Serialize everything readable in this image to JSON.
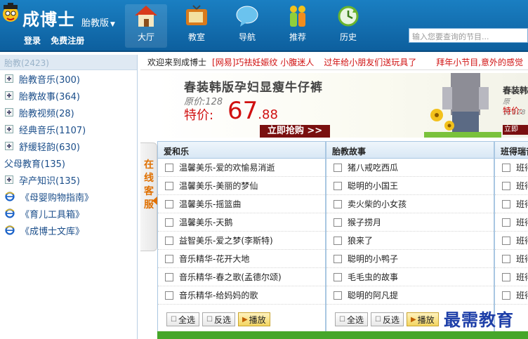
{
  "header": {
    "logo_title": "成博士",
    "logo_sub": "胎教版",
    "auth": {
      "login": "登录",
      "register": "免费注册"
    },
    "nav": [
      {
        "label": "大厅",
        "icon": "house-icon"
      },
      {
        "label": "教室",
        "icon": "tv-icon"
      },
      {
        "label": "导航",
        "icon": "chat-bubble-icon"
      },
      {
        "label": "推荐",
        "icon": "people-icon"
      },
      {
        "label": "历史",
        "icon": "history-refresh-icon"
      }
    ],
    "search_placeholder": "输入您要查询的节目..."
  },
  "sidebar": {
    "header": "胎教(2423)",
    "items": [
      {
        "label": "胎教音乐(300)",
        "type": "plus"
      },
      {
        "label": "胎教故事(364)",
        "type": "plus"
      },
      {
        "label": "胎教视频(28)",
        "type": "plus"
      },
      {
        "label": "经典音乐(1107)",
        "type": "plus"
      },
      {
        "label": "舒缓轻韵(630)",
        "type": "plus"
      }
    ],
    "root": "父母教育(135)",
    "sub": {
      "label": "孕产知识(135)",
      "type": "plus"
    },
    "links": [
      "《母婴购物指南》",
      "《育儿工具箱》",
      "《成博士文库》"
    ]
  },
  "ticker": {
    "welcome": "欢迎来到成博士",
    "items": [
      "[网易]巧祛妊娠纹 小腹迷人",
      "过年给小朋友们送玩具了",
      "拜年小节目,意外的感觉"
    ]
  },
  "banner": {
    "title": "春装韩版孕妇显瘦牛仔裤",
    "original_price": "原价:128",
    "sale_label": "特价:",
    "price_main": "67",
    "price_decimal": ".88",
    "buy_button": "立即抢购 >>",
    "second_title": "春装韩",
    "second_orig": "原价:128",
    "second_sale": "特价:",
    "second_btn": "立即"
  },
  "service": {
    "label": "在线客服"
  },
  "panels": [
    {
      "title": "爱和乐",
      "rows": [
        "温馨美乐-爱的欢愉易消逝",
        "温馨美乐-美丽的梦仙",
        "温馨美乐-摇篮曲",
        "温馨美乐-天鹅",
        "益智美乐-爱之梦(李斯特)",
        "音乐精华-花开大地",
        "音乐精华-春之歌(孟德尔颂)",
        "音乐精华-给妈妈的歌"
      ]
    },
    {
      "title": "胎教故事",
      "rows": [
        "猪八戒吃西瓜",
        "聪明的小国王",
        "卖火柴的小女孩",
        "猴子捞月",
        "狼来了",
        "聪明的小鸭子",
        "毛毛虫的故事",
        "聪明的阿凡提"
      ]
    },
    {
      "title": "班得瑞音",
      "rows": [
        "班得",
        "班得",
        "班得",
        "班得",
        "班得",
        "班得",
        "班得",
        "班得"
      ]
    }
  ],
  "buttons": {
    "select_all": "全选",
    "invert": "反选",
    "play": "播放"
  },
  "watermark": "最需教育"
}
